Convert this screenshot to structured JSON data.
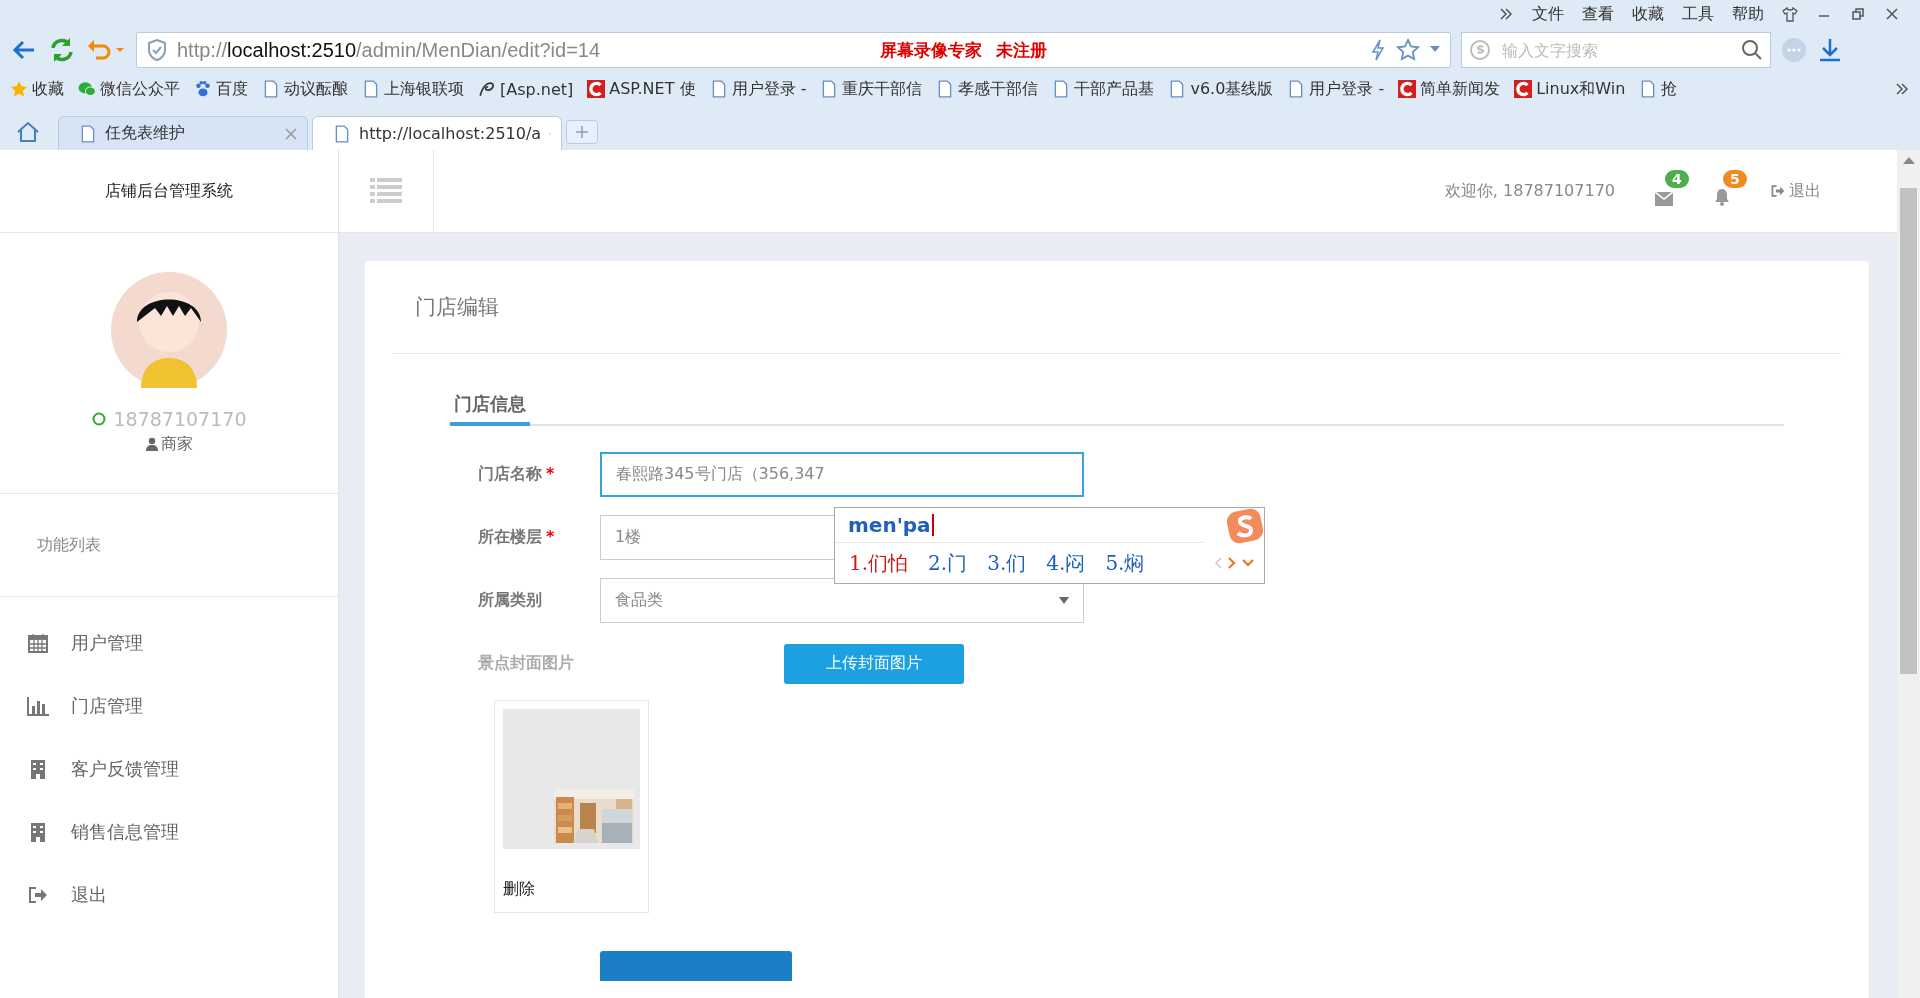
{
  "browser": {
    "menu": [
      "文件",
      "查看",
      "收藏",
      "工具",
      "帮助"
    ],
    "url_host": "http://localhost:2510",
    "url_path": "/admin/MenDian/edit?id=14",
    "watermark": [
      "屏幕录像专家",
      "未注册"
    ],
    "search": {
      "placeholder": "输入文字搜索"
    },
    "bookmarks": [
      {
        "label": "收藏",
        "kind": "star"
      },
      {
        "label": "微信公众平",
        "kind": "chat"
      },
      {
        "label": "百度",
        "kind": "paw"
      },
      {
        "label": "动议酝酿",
        "kind": "page"
      },
      {
        "label": "上海银联项",
        "kind": "page"
      },
      {
        "label": "[Asp.net]",
        "kind": "swirl"
      },
      {
        "label": "ASP.NET 使",
        "kind": "c"
      },
      {
        "label": "用户登录 -",
        "kind": "page"
      },
      {
        "label": "重庆干部信",
        "kind": "page"
      },
      {
        "label": "孝感干部信",
        "kind": "page"
      },
      {
        "label": "干部产品基",
        "kind": "page"
      },
      {
        "label": "v6.0基线版",
        "kind": "page"
      },
      {
        "label": "用户登录 -",
        "kind": "page"
      },
      {
        "label": "简单新闻发",
        "kind": "c"
      },
      {
        "label": "Linux和Win",
        "kind": "c"
      },
      {
        "label": "抢",
        "kind": "page"
      }
    ],
    "tabs": [
      {
        "label": "任免表维护",
        "selected": false
      },
      {
        "label": "http://localhost:2510/a",
        "selected": true
      }
    ]
  },
  "app": {
    "title": "店铺后台管理系统",
    "header": {
      "welcome": "欢迎你, 18787107170",
      "mail_count": "4",
      "bell_count": "5",
      "logout": "退出"
    },
    "profile": {
      "phone": "18787107170",
      "role": "商家"
    },
    "menu_heading": "功能列表",
    "nav": [
      {
        "label": "用户管理",
        "kind": "calendar"
      },
      {
        "label": "门店管理",
        "kind": "chart"
      },
      {
        "label": "客户反馈管理",
        "kind": "building"
      },
      {
        "label": "销售信息管理",
        "kind": "building"
      },
      {
        "label": "退出",
        "kind": "exit"
      }
    ],
    "page_title": "门店编辑",
    "section_tab": {
      "label": "门店信息",
      "selected": true
    },
    "fields": [
      {
        "label": "门店名称",
        "required_mark": "*",
        "value": "春熙路345号门店（356,347",
        "kind": "text",
        "focused": true
      },
      {
        "label": "所在楼层",
        "required_mark": "*",
        "value": "1楼",
        "kind": "text",
        "focused": false
      },
      {
        "label": "所属类别",
        "value": "食品类",
        "kind": "select",
        "focused": false
      }
    ],
    "cover_label": "景点封面图片",
    "upload_button": "上传封面图片",
    "delete_label": "删除"
  },
  "ime": {
    "composition": "men'pa",
    "candidates": [
      {
        "label": "1.们怕",
        "selected": true
      },
      {
        "label": "2.门",
        "selected": false
      },
      {
        "label": "3.们",
        "selected": false
      },
      {
        "label": "4.闷",
        "selected": false
      },
      {
        "label": "5.焖",
        "selected": false
      }
    ]
  }
}
